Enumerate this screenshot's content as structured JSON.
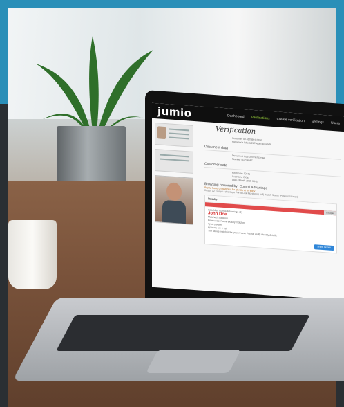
{
  "app": {
    "logo": "jumio",
    "nav": [
      "Dashboard",
      "Verifications",
      "Create verification",
      "Settings",
      "Users"
    ],
    "active_nav_index": 1
  },
  "verification": {
    "title": "Verification",
    "fields": [
      {
        "label": "Customer ID",
        "value": "4678901-2890"
      },
      {
        "label": "Reference",
        "value": "9dfe8d2b70ebf78c4a0e9f"
      },
      {
        "label": "Document type",
        "value": "Driving license"
      },
      {
        "label": "Number",
        "value": "D1234567"
      },
      {
        "label": "Firstname",
        "value": "JOHN"
      },
      {
        "label": "Lastname",
        "value": "DOE"
      },
      {
        "label": "Date of birth",
        "value": "1985-08-15"
      }
    ],
    "document_section": "Document data",
    "customer_section": "Customer data",
    "browsing_line": "Browsing powered by: Compli Advantage",
    "warn_line": "Profile found on watchlist for identity at an early",
    "info_line": "Result 12   Compli Advantage Portal Link   Monitoring (off)   Watch Status (Potential Match)"
  },
  "result": {
    "header": "Results",
    "right_tag": "Collapse",
    "match_title": "Watchlist: Compli Advantage (1)",
    "name": "John Doe",
    "details": [
      "Matched: Sanction",
      "Relevance: Name exactly matches",
      "Type: person",
      "Appears on: 1 list"
    ],
    "note": "The above match is for your review. Please verify identity details.",
    "button_label": "Show details"
  },
  "colors": {
    "brand_green": "#9ad13c",
    "alert_red": "#e14b4b",
    "primary_blue": "#2f86d8",
    "teal_band": "#2a8fb8"
  }
}
